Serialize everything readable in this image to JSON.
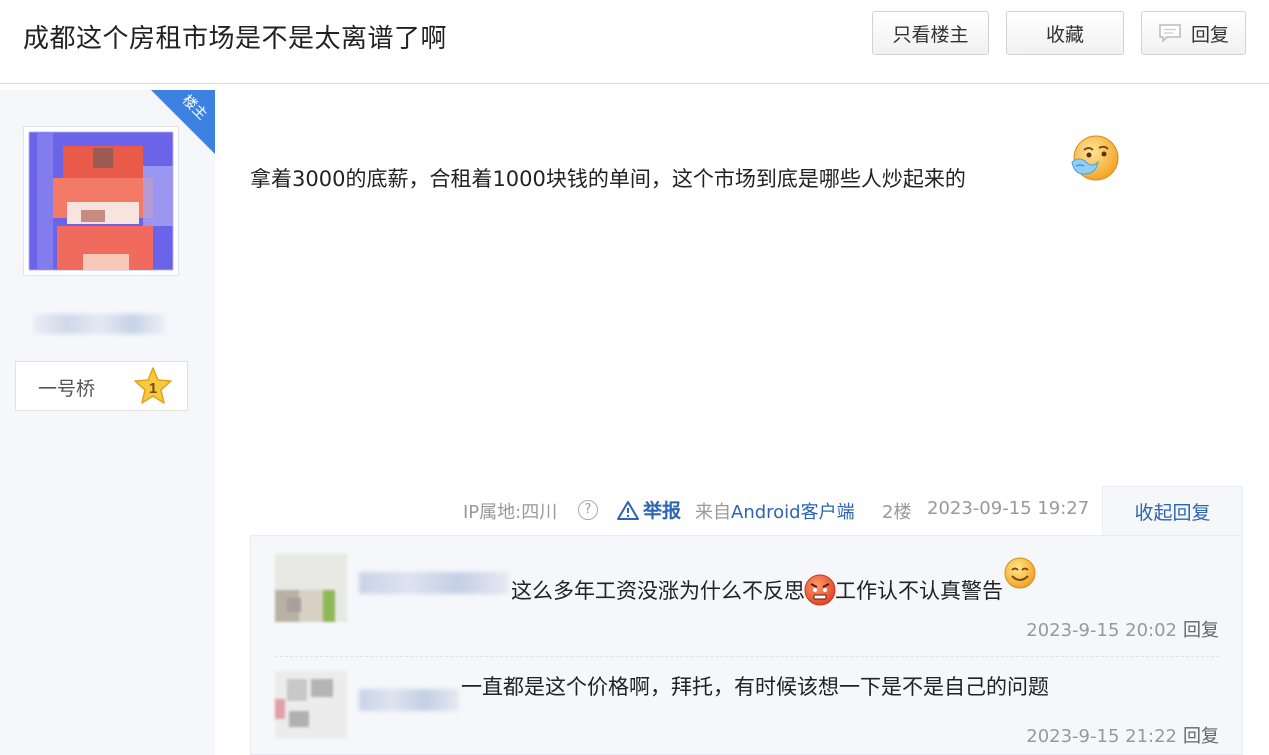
{
  "header": {
    "title": "成都这个房租市场是不是太离谱了啊",
    "only_owner_label": "只看楼主",
    "favorite_label": "收藏",
    "reply_label": "回复"
  },
  "author": {
    "badge": "楼主",
    "level_name": "一号桥",
    "level_number": "1"
  },
  "post": {
    "content": "拿着3000的底薪，合租着1000块钱的单间，这个市场到底是哪些人炒起来的",
    "ip_location": "IP属地:四川",
    "report_label": "举报",
    "source_prefix": "来自",
    "source_app": "Android客户端",
    "floor": "2楼",
    "time": "2023-09-15 19:27",
    "collapse_label": "收起回复"
  },
  "replies": [
    {
      "text_a": "这么多年工资没涨为什么不反思",
      "text_b": "工作认不认真警告",
      "time": "2023-9-15 20:02",
      "reply_label": "回复"
    },
    {
      "text_a": "一直都是这个价格啊，拜托，有时候该想一下是不是自己的问题",
      "time": "2023-9-15 21:22",
      "reply_label": "回复"
    }
  ],
  "colors": {
    "accent": "#2d64b3",
    "badge_blue": "#3d82e0",
    "panel_bg": "#f5f7fa"
  },
  "icons": [
    "reply-bubble-icon",
    "question-icon",
    "warning-icon",
    "star-level-icon",
    "sick-emoji-icon",
    "angry-emoji-icon",
    "smile-emoji-icon"
  ]
}
